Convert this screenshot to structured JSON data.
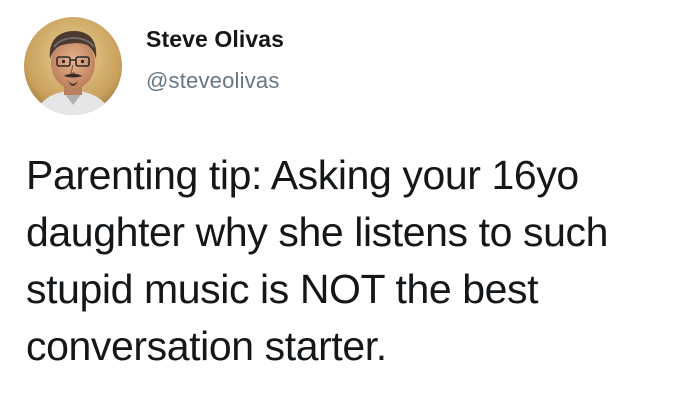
{
  "user": {
    "display_name": "Steve Olivas",
    "handle": "@steveolivas",
    "avatar_icon": "profile-photo"
  },
  "tweet": {
    "text_lines": [
      "Parenting tip: Asking your 16yo",
      "daughter why she listens to such",
      "stupid music is NOT the best",
      "conversation starter."
    ]
  },
  "colors": {
    "text_primary": "#14171a",
    "text_secondary": "#657786",
    "background": "#ffffff"
  }
}
